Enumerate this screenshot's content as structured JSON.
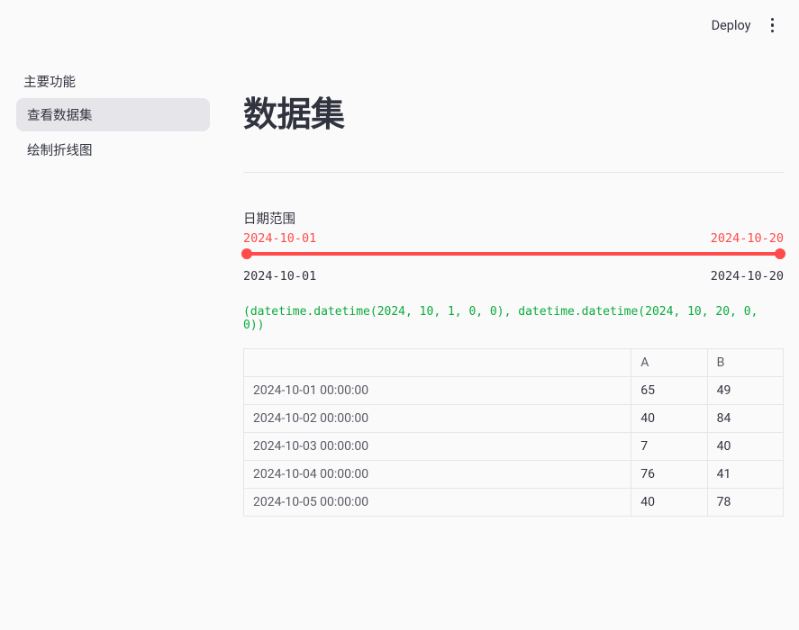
{
  "topbar": {
    "deploy": "Deploy"
  },
  "sidebar": {
    "section": "主要功能",
    "items": [
      {
        "label": "查看数据集",
        "active": true
      },
      {
        "label": "绘制折线图",
        "active": false
      }
    ]
  },
  "page": {
    "title": "数据集"
  },
  "slider": {
    "label": "日期范围",
    "value_start": "2024-10-01",
    "value_end": "2024-10-20",
    "min": "2024-10-01",
    "max": "2024-10-20"
  },
  "debug": {
    "tuple": "(datetime.datetime(2024, 10, 1, 0, 0), datetime.datetime(2024, 10, 20, 0, 0))"
  },
  "table": {
    "columns": [
      "",
      "A",
      "B"
    ],
    "rows": [
      {
        "idx": "2024-10-01 00:00:00",
        "A": "65",
        "B": "49"
      },
      {
        "idx": "2024-10-02 00:00:00",
        "A": "40",
        "B": "84"
      },
      {
        "idx": "2024-10-03 00:00:00",
        "A": "7",
        "B": "40"
      },
      {
        "idx": "2024-10-04 00:00:00",
        "A": "76",
        "B": "41"
      },
      {
        "idx": "2024-10-05 00:00:00",
        "A": "40",
        "B": "78"
      }
    ]
  }
}
